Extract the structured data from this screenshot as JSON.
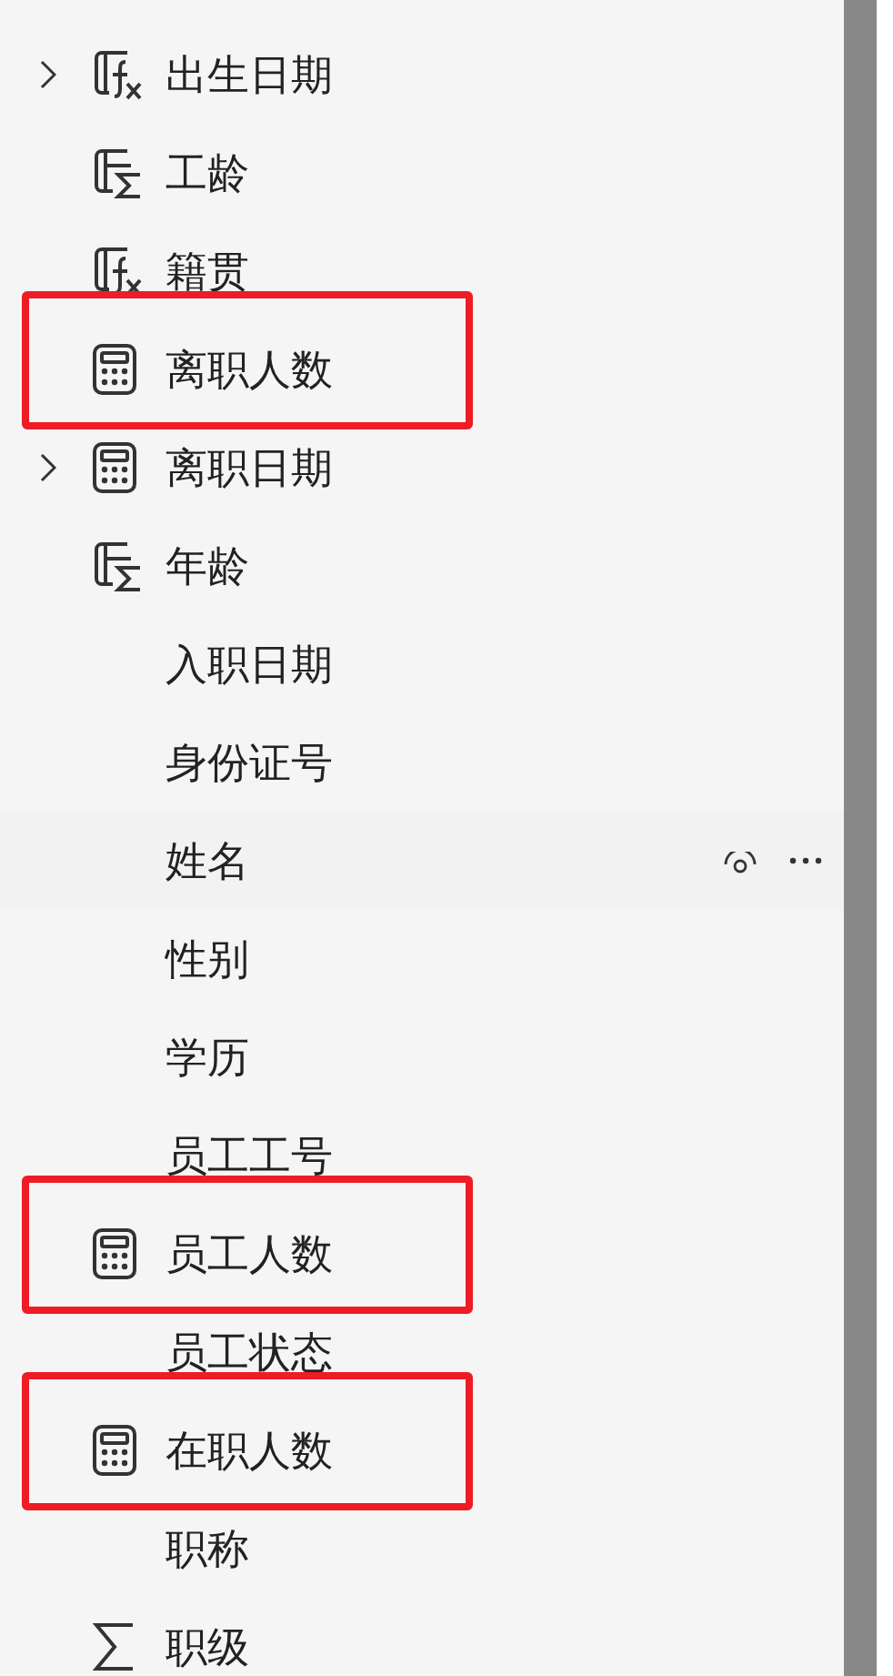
{
  "fields": [
    {
      "label": "出生日期",
      "kind": "formula",
      "expandable": true,
      "highlighted": false,
      "hovered": false
    },
    {
      "label": "工龄",
      "kind": "calc-column",
      "expandable": false,
      "highlighted": false,
      "hovered": false
    },
    {
      "label": "籍贯",
      "kind": "formula",
      "expandable": false,
      "highlighted": false,
      "hovered": false
    },
    {
      "label": "离职人数",
      "kind": "measure",
      "expandable": false,
      "highlighted": true,
      "hovered": false
    },
    {
      "label": "离职日期",
      "kind": "measure",
      "expandable": true,
      "highlighted": false,
      "hovered": false
    },
    {
      "label": "年龄",
      "kind": "calc-column",
      "expandable": false,
      "highlighted": false,
      "hovered": false
    },
    {
      "label": "入职日期",
      "kind": "plain",
      "expandable": false,
      "highlighted": false,
      "hovered": false
    },
    {
      "label": "身份证号",
      "kind": "plain",
      "expandable": false,
      "highlighted": false,
      "hovered": false
    },
    {
      "label": "姓名",
      "kind": "plain",
      "expandable": false,
      "highlighted": false,
      "hovered": true
    },
    {
      "label": "性别",
      "kind": "plain",
      "expandable": false,
      "highlighted": false,
      "hovered": false
    },
    {
      "label": "学历",
      "kind": "plain",
      "expandable": false,
      "highlighted": false,
      "hovered": false
    },
    {
      "label": "员工工号",
      "kind": "plain",
      "expandable": false,
      "highlighted": false,
      "hovered": false
    },
    {
      "label": "员工人数",
      "kind": "measure",
      "expandable": false,
      "highlighted": true,
      "hovered": false
    },
    {
      "label": "员工状态",
      "kind": "plain",
      "expandable": false,
      "highlighted": false,
      "hovered": false
    },
    {
      "label": "在职人数",
      "kind": "measure",
      "expandable": false,
      "highlighted": true,
      "hovered": false
    },
    {
      "label": "职称",
      "kind": "plain",
      "expandable": false,
      "highlighted": false,
      "hovered": false
    },
    {
      "label": "职级",
      "kind": "sum",
      "expandable": false,
      "highlighted": false,
      "hovered": false
    }
  ]
}
